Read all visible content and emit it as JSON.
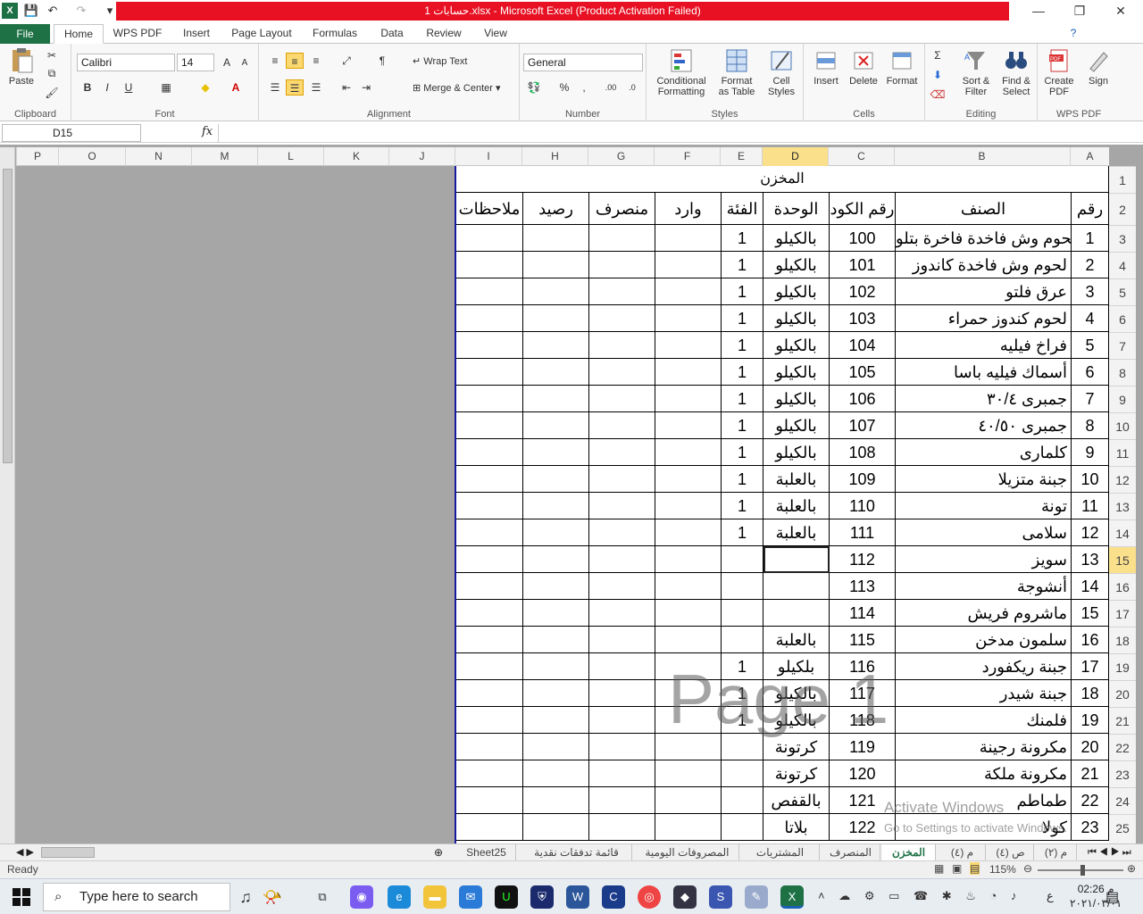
{
  "title": {
    "text": "حسابات 1.xlsx  -  Microsoft Excel (Product Activation Failed)"
  },
  "window": {
    "minimize": "—",
    "restore": "❐",
    "close": "✕"
  },
  "tabs": [
    "File",
    "Home",
    "WPS PDF",
    "Insert",
    "Page Layout",
    "Formulas",
    "Data",
    "Review",
    "View"
  ],
  "ribbon": {
    "clipboard": {
      "label": "Clipboard",
      "paste": "Paste"
    },
    "font": {
      "label": "Font",
      "name": "Calibri",
      "size": "14",
      "bold": "B",
      "italic": "I",
      "underline": "U"
    },
    "alignment": {
      "label": "Alignment",
      "wrap": "Wrap Text",
      "merge": "Merge & Center"
    },
    "number": {
      "label": "Number",
      "format": "General",
      "percent": "%",
      "comma": ","
    },
    "styles": {
      "label": "Styles",
      "conditional": [
        "Conditional",
        "Formatting"
      ],
      "format_table": [
        "Format",
        "as Table"
      ],
      "cell_styles": [
        "Cell",
        "Styles"
      ]
    },
    "cells": {
      "label": "Cells",
      "insert": "Insert",
      "delete": "Delete",
      "format": "Format"
    },
    "editing": {
      "label": "Editing",
      "sort": [
        "Sort &",
        "Filter"
      ],
      "find": [
        "Find &",
        "Select"
      ]
    },
    "wps": {
      "label": "WPS PDF",
      "create": [
        "Create",
        "PDF"
      ],
      "sign": "Sign"
    }
  },
  "formula_bar": {
    "name_box": "D15",
    "fx": "fx",
    "value": ""
  },
  "columns": [
    "P",
    "O",
    "N",
    "M",
    "L",
    "K",
    "J",
    "I",
    "H",
    "G",
    "F",
    "E",
    "D",
    "C",
    "B",
    "A"
  ],
  "selected_column": "D",
  "row_numbers": [
    "1",
    "2",
    "3",
    "4",
    "5",
    "6",
    "7",
    "8",
    "9",
    "10",
    "11",
    "12",
    "13",
    "14",
    "15",
    "16",
    "17",
    "18",
    "19",
    "20",
    "21",
    "22",
    "23",
    "24",
    "25"
  ],
  "selected_row": "15",
  "sheet": {
    "title": "المخزن",
    "headers": {
      "A": "رقم",
      "B": "الصنف",
      "C": "رقم الكود",
      "D": "الوحدة",
      "E": "الفئة",
      "F": "وارد",
      "G": "منصرف",
      "H": "رصيد",
      "I": "ملاحظات"
    },
    "rows": [
      {
        "A": "1",
        "B": "لحوم وش فاخدة فاخرة  بتلو",
        "C": "100",
        "D": "بالكيلو",
        "E": "1"
      },
      {
        "A": "2",
        "B": "لحوم وش فاخدة كاندوز",
        "C": "101",
        "D": "بالكيلو",
        "E": "1"
      },
      {
        "A": "3",
        "B": "عرق فلتو",
        "C": "102",
        "D": "بالكيلو",
        "E": "1"
      },
      {
        "A": "4",
        "B": "لحوم كندوز حمراء",
        "C": "103",
        "D": "بالكيلو",
        "E": "1"
      },
      {
        "A": "5",
        "B": "فراخ فيليه",
        "C": "104",
        "D": "بالكيلو",
        "E": "1"
      },
      {
        "A": "6",
        "B": "أسماك فيليه باسا",
        "C": "105",
        "D": "بالكيلو",
        "E": "1"
      },
      {
        "A": "7",
        "B": "جمبرى ٣٠/٤",
        "C": "106",
        "D": "بالكيلو",
        "E": "1"
      },
      {
        "A": "8",
        "B": "جمبرى ٤٠/٥٠",
        "C": "107",
        "D": "بالكيلو",
        "E": "1"
      },
      {
        "A": "9",
        "B": "كلمارى",
        "C": "108",
        "D": "بالكيلو",
        "E": "1"
      },
      {
        "A": "10",
        "B": "جبنة متزيلا",
        "C": "109",
        "D": "بالعلبة",
        "E": "1"
      },
      {
        "A": "11",
        "B": "تونة",
        "C": "110",
        "D": "بالعلبة",
        "E": "1"
      },
      {
        "A": "12",
        "B": "سلامى",
        "C": "111",
        "D": "بالعلبة",
        "E": "1"
      },
      {
        "A": "13",
        "B": "سويز",
        "C": "112",
        "D": "",
        "E": ""
      },
      {
        "A": "14",
        "B": "أنشوجة",
        "C": "113",
        "D": "",
        "E": ""
      },
      {
        "A": "15",
        "B": "ماشروم فريش",
        "C": "114",
        "D": "",
        "E": ""
      },
      {
        "A": "16",
        "B": "سلمون مدخن",
        "C": "115",
        "D": "بالعلبة",
        "E": ""
      },
      {
        "A": "17",
        "B": "جبنة ريكفورد",
        "C": "116",
        "D": "بلكيلو",
        "E": "1"
      },
      {
        "A": "18",
        "B": "جبنة شيدر",
        "C": "117",
        "D": "بالكيلو",
        "E": "1"
      },
      {
        "A": "19",
        "B": "فلمنك",
        "C": "118",
        "D": "بالكيلو",
        "E": "1"
      },
      {
        "A": "20",
        "B": "مكرونة رجينة",
        "C": "119",
        "D": "كرتونة",
        "E": ""
      },
      {
        "A": "21",
        "B": "مكرونة ملكة",
        "C": "120",
        "D": "كرتونة",
        "E": ""
      },
      {
        "A": "22",
        "B": "طماطم",
        "C": "121",
        "D": "بالقفص",
        "E": ""
      },
      {
        "A": "23",
        "B": "كولا",
        "C": "122",
        "D": "بلاتا",
        "E": ""
      }
    ]
  },
  "watermarks": {
    "page": "Page 1",
    "activate1": "Activate Windows",
    "activate2": "Go to Settings to activate Windows."
  },
  "sheet_tabs": [
    "م (٢)",
    "ص (٤)",
    "م (٤)",
    "المخزن",
    "المنصرف",
    "المشتريات",
    "المصروفات اليومية",
    "قائمة تدفقات نقدية",
    "Sheet25"
  ],
  "active_sheet": "المخزن",
  "status": {
    "ready": "Ready",
    "zoom": "115%"
  },
  "taskbar": {
    "search_placeholder": "Type here to search",
    "time": "02:26 م",
    "date": "٢٠٢١/٠٣/٠١",
    "lang": "ع"
  }
}
